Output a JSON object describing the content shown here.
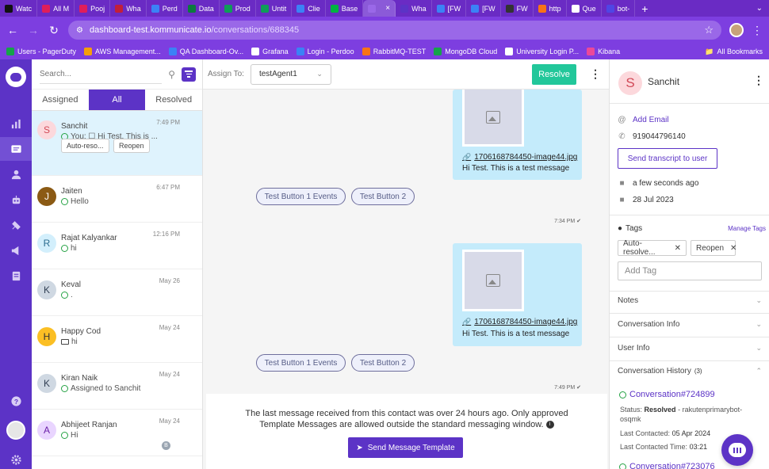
{
  "browser": {
    "tabs": [
      {
        "label": "Watc",
        "color": "#111111"
      },
      {
        "label": "All M",
        "color": "#e01e5a"
      },
      {
        "label": "Pooj",
        "color": "#e01e5a"
      },
      {
        "label": "Wha",
        "color": "#c21f3a"
      },
      {
        "label": "Perd",
        "color": "#3b82f6"
      },
      {
        "label": "Data",
        "color": "#0b7a3e"
      },
      {
        "label": "Prod",
        "color": "#0f9d58"
      },
      {
        "label": "Untit",
        "color": "#0f9d58"
      },
      {
        "label": "Clie",
        "color": "#3b82f6"
      },
      {
        "label": "Base",
        "color": "#00b341"
      },
      {
        "label": "",
        "color": "#9a68e8",
        "active": true
      },
      {
        "label": "Wha",
        "color": "#5c33c6"
      },
      {
        "label": "[FW",
        "color": "#3b82f6"
      },
      {
        "label": "[FW",
        "color": "#3b82f6"
      },
      {
        "label": "FW",
        "color": "#333333"
      },
      {
        "label": "http",
        "color": "#f97316"
      },
      {
        "label": "Que",
        "color": "#ffffff"
      },
      {
        "label": "bot-",
        "color": "#4f46e5"
      }
    ],
    "url_host": "dashboard-test.kommunicate.io",
    "url_path": "/conversations/688345",
    "bookmarks": [
      {
        "label": "Users - PagerDuty",
        "color": "#16a34a"
      },
      {
        "label": "AWS Management...",
        "color": "#f59e0b"
      },
      {
        "label": "QA Dashboard-Ov...",
        "color": "#3b82f6"
      },
      {
        "label": "Grafana",
        "color": "#ffffff"
      },
      {
        "label": "Login - Perdoo",
        "color": "#3b82f6"
      },
      {
        "label": "RabbitMQ-TEST",
        "color": "#f97316"
      },
      {
        "label": "MongoDB Cloud",
        "color": "#16a34a"
      },
      {
        "label": "University Login P...",
        "color": "#ffffff"
      },
      {
        "label": "Kibana",
        "color": "#ec4899"
      }
    ],
    "all_bookmarks": "All Bookmarks"
  },
  "convlist": {
    "search_placeholder": "Search...",
    "tabs": [
      "Assigned",
      "All",
      "Resolved"
    ],
    "items": [
      {
        "initial": "S",
        "name": "Sanchit",
        "time": "7:49 PM",
        "preview": "You: ☐ Hi Test. This is ...",
        "channel": "whatsapp",
        "avatar_bg": "#fcd8dc",
        "avatar_fg": "#d14a58",
        "chips": [
          "Auto-reso...",
          "Reopen"
        ]
      },
      {
        "initial": "J",
        "name": "Jaiten",
        "time": "6:47 PM",
        "preview": "Hello",
        "channel": "whatsapp",
        "avatar_bg": "#8b5a14",
        "avatar_fg": "#ffffff"
      },
      {
        "initial": "R",
        "name": "Rajat Kalyankar",
        "time": "12:16 PM",
        "preview": "hi",
        "channel": "whatsapp",
        "avatar_bg": "#d3effc",
        "avatar_fg": "#2b6d8f"
      },
      {
        "initial": "K",
        "name": "Keval",
        "time": "May 26",
        "preview": ".",
        "channel": "whatsapp",
        "avatar_bg": "#cfd8e2",
        "avatar_fg": "#334155"
      },
      {
        "initial": "H",
        "name": "Happy Cod",
        "time": "May 24",
        "preview": "hi",
        "channel": "web",
        "avatar_bg": "#fbbf24",
        "avatar_fg": "#333333"
      },
      {
        "initial": "K",
        "name": "Kiran Naik",
        "time": "May 24",
        "preview": "Assigned to Sanchit",
        "channel": "whatsapp",
        "avatar_bg": "#cfd8e2",
        "avatar_fg": "#334155"
      },
      {
        "initial": "A",
        "name": "Abhijeet Ranjan",
        "time": "May 24",
        "preview": "Hi",
        "channel": "whatsapp",
        "avatar_bg": "#e9d5ff",
        "avatar_fg": "#6b21a8",
        "badge": "B"
      }
    ]
  },
  "chat": {
    "assign_label": "Assign To:",
    "assignee": "testAgent1",
    "resolve_label": "Resolve",
    "messages": [
      {
        "file": "1706168784450-image44.jpg",
        "text": "Hi Test. This is a test message",
        "buttons": [
          "Test Button 1 Events",
          "Test Button 2"
        ],
        "time": "7:34 PM ✔"
      },
      {
        "file": "1706168784450-image44.jpg",
        "text": "Hi Test. This is a test message",
        "buttons": [
          "Test Button 1 Events",
          "Test Button 2"
        ],
        "time": "7:49 PM ✔"
      }
    ],
    "window_notice_1": "The last message received from this contact was over 24 hours ago. Only approved",
    "window_notice_2": "Template Messages are allowed outside the standard messaging window.",
    "send_template_label": "Send Message Template"
  },
  "profile": {
    "initial": "S",
    "name": "Sanchit",
    "add_email": "Add Email",
    "phone": "919044796140",
    "transcript_label": "Send transcript to user",
    "last_seen": "a few seconds ago",
    "created": "28 Jul 2023",
    "tags_title": "Tags",
    "manage_tags": "Manage Tags",
    "tags": [
      "Auto-resolve...",
      "Reopen"
    ],
    "add_tag_placeholder": "Add Tag",
    "sections": [
      "Notes",
      "Conversation Info",
      "User Info"
    ],
    "history_title": "Conversation History",
    "history_count": "(3)",
    "history": {
      "link": "Conversation#724899",
      "status_label": "Status:",
      "status_value": "Resolved",
      "status_rest": "- rakutenprimarybot-",
      "status_rest2": "osqmk",
      "last_contacted_label": "Last Contacted:",
      "last_contacted": "05 Apr 2024",
      "last_contacted_time_label": "Last Contacted Time:",
      "last_contacted_time": "03:21",
      "next_link": "Conversation#723076"
    }
  }
}
